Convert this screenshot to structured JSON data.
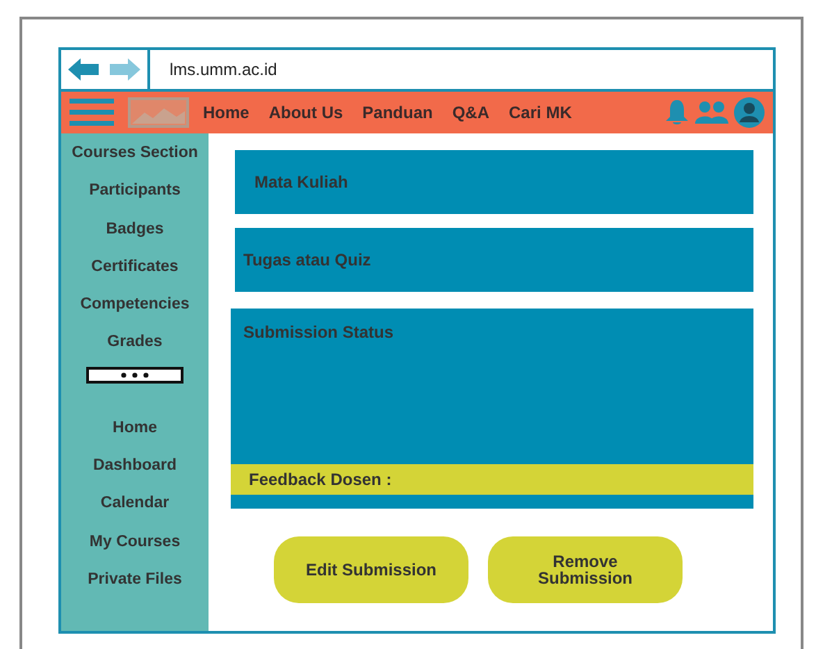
{
  "address_bar": {
    "url": "lms.umm.ac.id",
    "back_enabled": true,
    "forward_enabled": false
  },
  "nav": {
    "items": [
      "Home",
      "About Us",
      "Panduan",
      "Q&A",
      "Cari MK"
    ]
  },
  "sidebar": {
    "course_items": [
      "Courses Section",
      "Participants",
      "Badges",
      "Certificates",
      "Competencies",
      "Grades"
    ],
    "site_items": [
      "Home",
      "Dashboard",
      "Calendar",
      "My Courses",
      "Private Files"
    ]
  },
  "content": {
    "course_title": "Mata Kuliah",
    "assignment_title": "Tugas atau Quiz",
    "submission_status": "Submission Status",
    "feedback_label": "Feedback Dosen :"
  },
  "buttons": [
    {
      "label": "Edit Submission"
    },
    {
      "label": "Remove Submission"
    }
  ]
}
